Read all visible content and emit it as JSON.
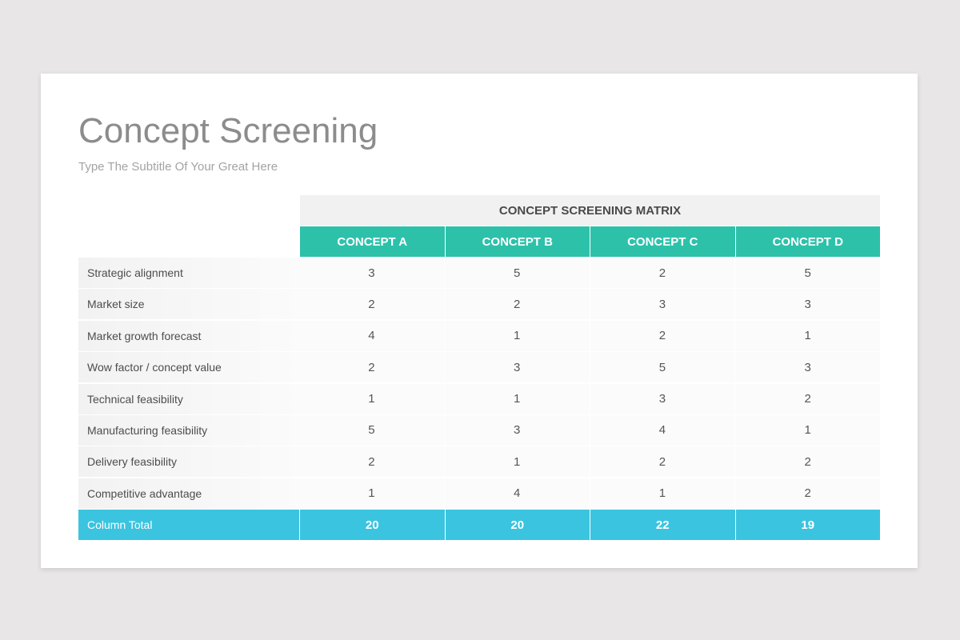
{
  "slide": {
    "title": "Concept Screening",
    "subtitle": "Type The Subtitle Of Your Great Here"
  },
  "matrix": {
    "header": "CONCEPT SCREENING MATRIX",
    "concepts": [
      "CONCEPT A",
      "CONCEPT B",
      "CONCEPT C",
      "CONCEPT D"
    ],
    "rows": [
      {
        "label": "Strategic alignment",
        "values": [
          "3",
          "5",
          "2",
          "5"
        ]
      },
      {
        "label": "Market size",
        "values": [
          "2",
          "2",
          "3",
          "3"
        ]
      },
      {
        "label": "Market growth forecast",
        "values": [
          "4",
          "1",
          "2",
          "1"
        ]
      },
      {
        "label": "Wow factor / concept value",
        "values": [
          "2",
          "3",
          "5",
          "3"
        ]
      },
      {
        "label": "Technical feasibility",
        "values": [
          "1",
          "1",
          "3",
          "2"
        ]
      },
      {
        "label": "Manufacturing feasibility",
        "values": [
          "5",
          "3",
          "4",
          "1"
        ]
      },
      {
        "label": "Delivery feasibility",
        "values": [
          "2",
          "1",
          "2",
          "2"
        ]
      },
      {
        "label": "Competitive advantage",
        "values": [
          "1",
          "4",
          "1",
          "2"
        ]
      }
    ],
    "total": {
      "label": "Column Total",
      "values": [
        "20",
        "20",
        "22",
        "19"
      ]
    }
  },
  "colors": {
    "concept_header": "#2dc1aa",
    "total_row": "#3ac4e0",
    "matrix_header_bg": "#f1f1f1",
    "title_text": "#8c8c8c"
  }
}
